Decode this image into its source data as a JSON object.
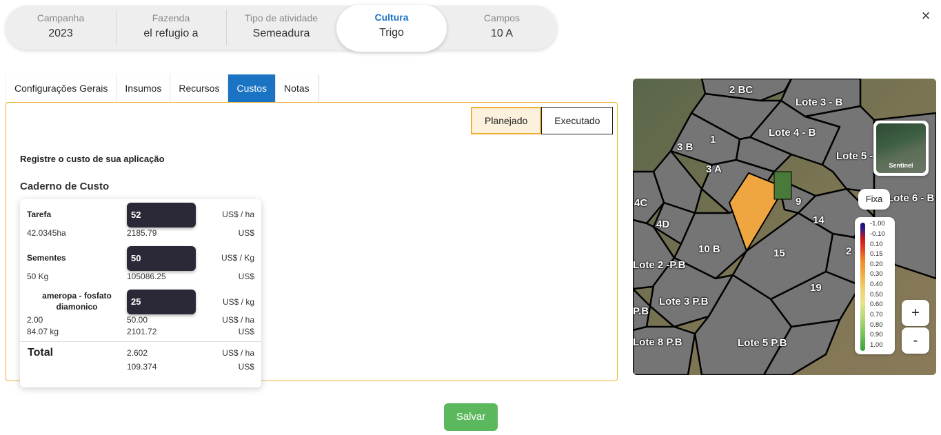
{
  "steps": [
    {
      "label": "Campanha",
      "value": "2023"
    },
    {
      "label": "Fazenda",
      "value": "el refugio a"
    },
    {
      "label": "Tipo de atividade",
      "value": "Semeadura"
    },
    {
      "label": "Cultura",
      "value": "Trigo"
    },
    {
      "label": "Campos",
      "value": "10 A"
    }
  ],
  "close_icon": "×",
  "tabs": [
    "Configurações Gerais",
    "Insumos",
    "Recursos",
    "Custos",
    "Notas"
  ],
  "toggle": {
    "planned": "Planejado",
    "executed": "Executado"
  },
  "subtitle": "Registre o custo de sua aplicação",
  "notebook_title": "Caderno de Custo",
  "cost": {
    "task": {
      "name": "Tarefa",
      "input": "52",
      "unit": "US$ / ha",
      "area": "42.0345ha",
      "total": "2185.79",
      "total_unit": "US$"
    },
    "seeds": {
      "name": "Sementes",
      "input": "50",
      "unit": "US$ / Kg",
      "qty": "50 Kg",
      "total": "105086.25",
      "total_unit": "US$"
    },
    "input": {
      "name": "ameropa - fosfato diamonico",
      "input": "25",
      "unit": "US$ / kg",
      "dose": "2.00",
      "dose_val": "50.00",
      "dose_unit": "US$ / ha",
      "qty": "84.07 kg",
      "total": "2101.72",
      "total_unit": "US$"
    },
    "total": {
      "label": "Total",
      "per_ha": "2.602",
      "per_ha_unit": "US$ / ha",
      "sum": "109.374",
      "sum_unit": "US$"
    }
  },
  "save_label": "Salvar",
  "map": {
    "fields": [
      "2 BC",
      "Lote 3 - B",
      "Lote 4 - B",
      "1",
      "3 B",
      "3 A",
      "Lote 5 -",
      "Lote 6 - B",
      "9",
      "4C",
      "4D",
      "14",
      "10 B",
      "15",
      "2",
      "Lote 2 -P.B",
      "19",
      "Lote 3 P.B",
      "P.B",
      "Lote 5 P.B",
      "Lote 8 P.B"
    ],
    "layer": "Sentinel",
    "mode": "Fixa",
    "legend": [
      "-1.00",
      "-0.10",
      "0.10",
      "0.15",
      "0.20",
      "0.30",
      "0.40",
      "0.50",
      "0.60",
      "0.70",
      "0.80",
      "0.90",
      "1.00"
    ],
    "zoom_in": "+",
    "zoom_out": "-",
    "colors": {
      "field": "#757575",
      "selected": "#f0a640",
      "border": "#000000"
    }
  }
}
